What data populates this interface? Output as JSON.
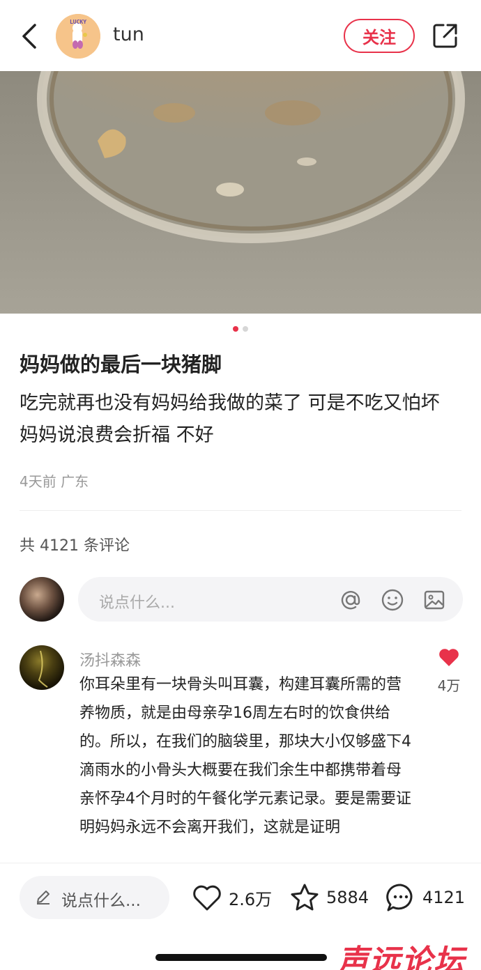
{
  "header": {
    "username": "tun",
    "avatar_text": "LUCKY",
    "follow_label": "关注",
    "icons": {
      "back": "chevron-left-icon",
      "share": "share-icon"
    }
  },
  "carousel": {
    "total": 2,
    "active": 1
  },
  "post": {
    "title": "妈妈做的最后一块猪脚",
    "description": "吃完就再也没有妈妈给我做的菜了 可是不吃又怕坏 妈妈说浪费会折福 不好",
    "meta": "4天前 广东"
  },
  "comments_section": {
    "count_label": "共 4121 条评论",
    "input_placeholder": "说点什么...",
    "icons": [
      "at-icon",
      "emoji-icon",
      "image-icon"
    ]
  },
  "comments": [
    {
      "author": "汤抖森森",
      "text": "你耳朵里有一块骨头叫耳囊，构建耳囊所需的营养物质，就是由母亲孕16周左右时的饮食供给的。所以，在我们的脑袋里，那块大小仅够盛下4滴雨水的小骨头大概要在我们余生中都携带着母亲怀孕4个月时的午餐化学元素记录。要是需要证明妈妈永远不会离开我们，这就是证明",
      "likes": "4万"
    }
  ],
  "bottom_bar": {
    "input_placeholder": "说点什么...",
    "likes": "2.6万",
    "stars": "5884",
    "comments": "4121"
  },
  "watermark": "声远论坛",
  "colors": {
    "accent": "#e8324a",
    "muted": "#999999",
    "input_bg": "#f4f4f6"
  }
}
